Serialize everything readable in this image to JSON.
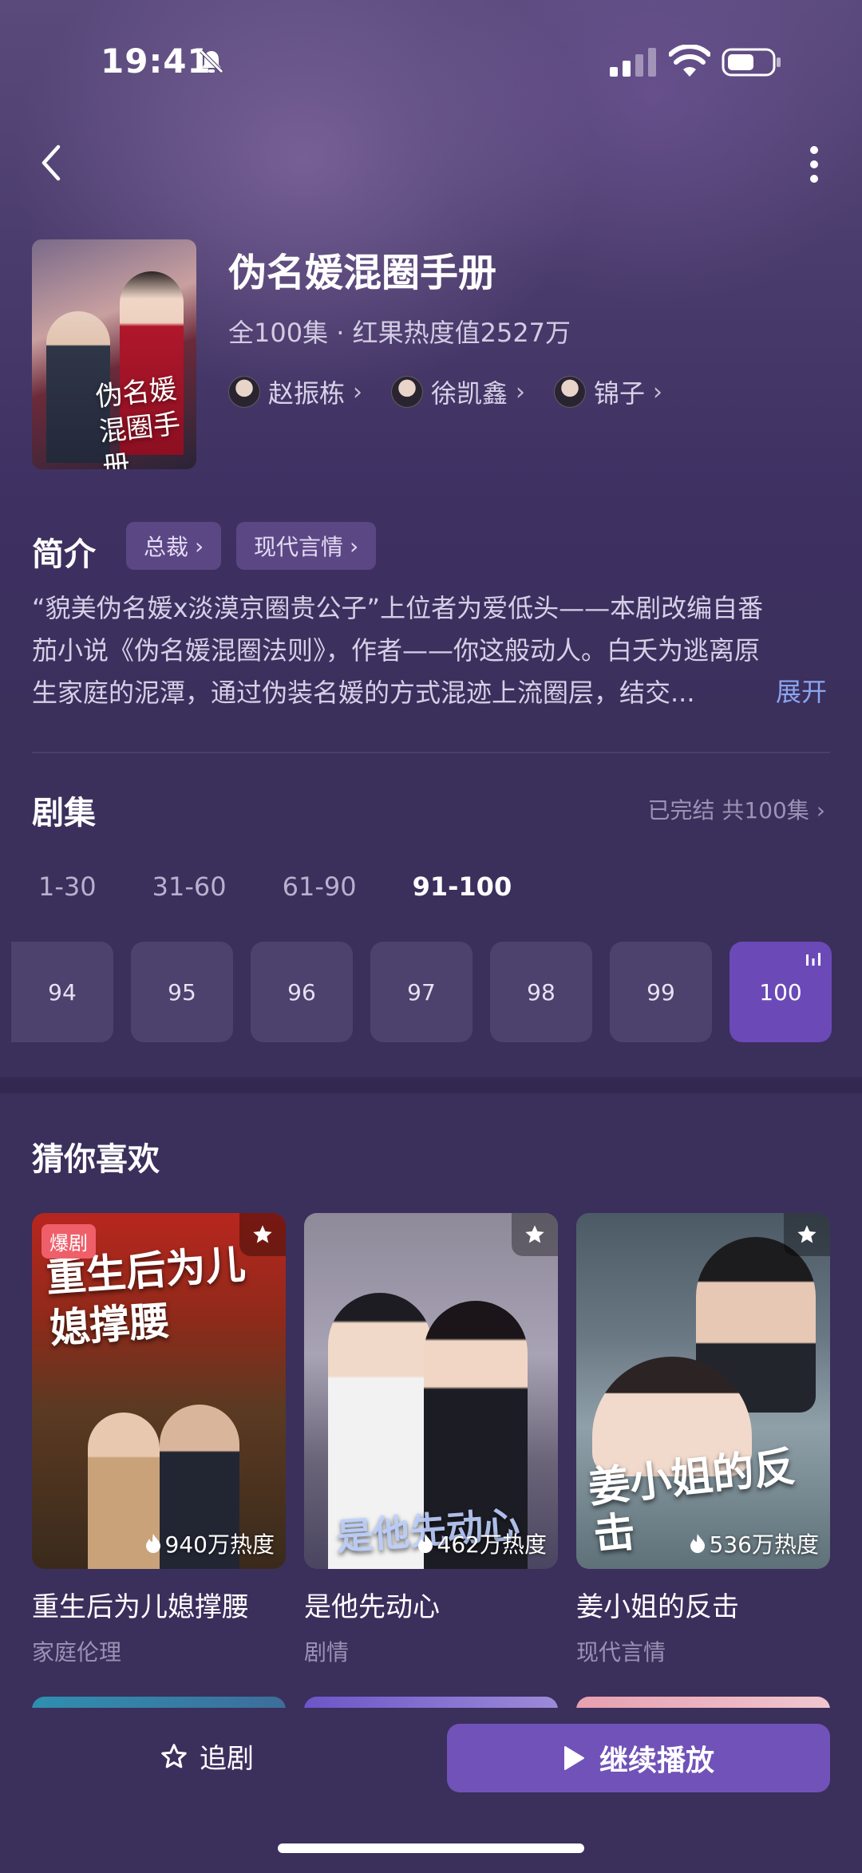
{
  "status_bar": {
    "time": "19:41"
  },
  "header": {
    "title": "伪名媛混圈手册",
    "meta": "全100集 · 红果热度值2527万",
    "poster_caption": "伪名媛混圈手册",
    "actors": [
      {
        "name": "赵振栋"
      },
      {
        "name": "徐凯鑫"
      },
      {
        "name": "锦子"
      }
    ]
  },
  "intro": {
    "label": "简介",
    "tags": [
      "总裁",
      "现代言情"
    ],
    "lines": [
      "“貌美伪名媛x淡漠京圈贵公子”上位者为爱低头——本剧改编自番",
      "茄小说《伪名媛混圈法则》，作者——你这般动人。白夭为逃离原",
      "生家庭的泥潭，通过伪装名媛的方式混迹上流圈层，结交..."
    ],
    "expand": "展开"
  },
  "episodes": {
    "label": "剧集",
    "status": "已完结 共100集",
    "ranges": [
      "1-30",
      "31-60",
      "61-90",
      "91-100"
    ],
    "active_range": "91-100",
    "items": [
      "94",
      "95",
      "96",
      "97",
      "98",
      "99",
      "100"
    ],
    "current": "100"
  },
  "recommend": {
    "label": "猜你喜欢",
    "items": [
      {
        "name": "重生后为儿媳撑腰",
        "genre": "家庭伦理",
        "heat": "940万热度",
        "badge": "爆剧",
        "cover_text": "重生后为儿媳撑腰"
      },
      {
        "name": "是他先动心",
        "genre": "剧情",
        "heat": "462万热度",
        "cover_text": "是他先动心"
      },
      {
        "name": "姜小姐的反击",
        "genre": "现代言情",
        "heat": "536万热度",
        "cover_text": "姜小姐的反击"
      }
    ]
  },
  "bottom": {
    "follow_label": "追剧",
    "play_label": "继续播放"
  },
  "colors": {
    "background": "#3b2f5c",
    "accent": "#7152b8",
    "link": "#8aa6ef",
    "badge": "#ef5f6a"
  }
}
